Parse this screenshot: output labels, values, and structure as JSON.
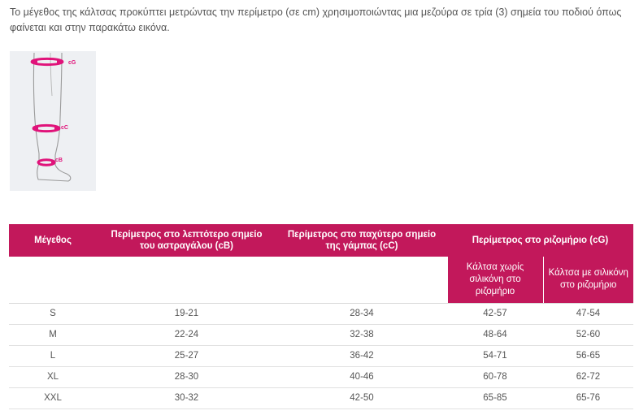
{
  "intro": {
    "text": "Το μέγεθος της κάλτσας προκύπτει μετρώντας την περίμετρο (σε cm) χρησιμοποιώντας μια μεζούρα σε τρία (3) σημεία του ποδιού όπως φαίνεται και στην παρακάτω εικόνα."
  },
  "figure": {
    "labels": {
      "cG": "cG",
      "cC": "cC",
      "cB": "cB"
    },
    "accent_color": "#e0137a",
    "background_color": "#eef0f3"
  },
  "table": {
    "header_color": "#c2185b",
    "headers": {
      "size": "Μέγεθος",
      "ankle": "Περίμετρος στο λεπτότερο σημείο του αστραγάλου (cB)",
      "calf": "Περίμετρος στο παχύτερο σημείο της γάμπας (cC)",
      "thigh": "Περίμετρος στο ριζομήριο (cG)",
      "thigh_no_silicone": "Κάλτσα χωρίς σιλικόνη στο ριζομήριο",
      "thigh_silicone": "Κάλτσα με σιλικόνη στο ριζομήριο"
    },
    "rows": [
      [
        "S",
        "19-21",
        "28-34",
        "42-57",
        "47-54"
      ],
      [
        "M",
        "22-24",
        "32-38",
        "48-64",
        "52-60"
      ],
      [
        "L",
        "25-27",
        "36-42",
        "54-71",
        "56-65"
      ],
      [
        "XL",
        "28-30",
        "40-46",
        "60-78",
        "62-72"
      ],
      [
        "XXL",
        "30-32",
        "42-50",
        "65-85",
        "65-76"
      ]
    ]
  }
}
